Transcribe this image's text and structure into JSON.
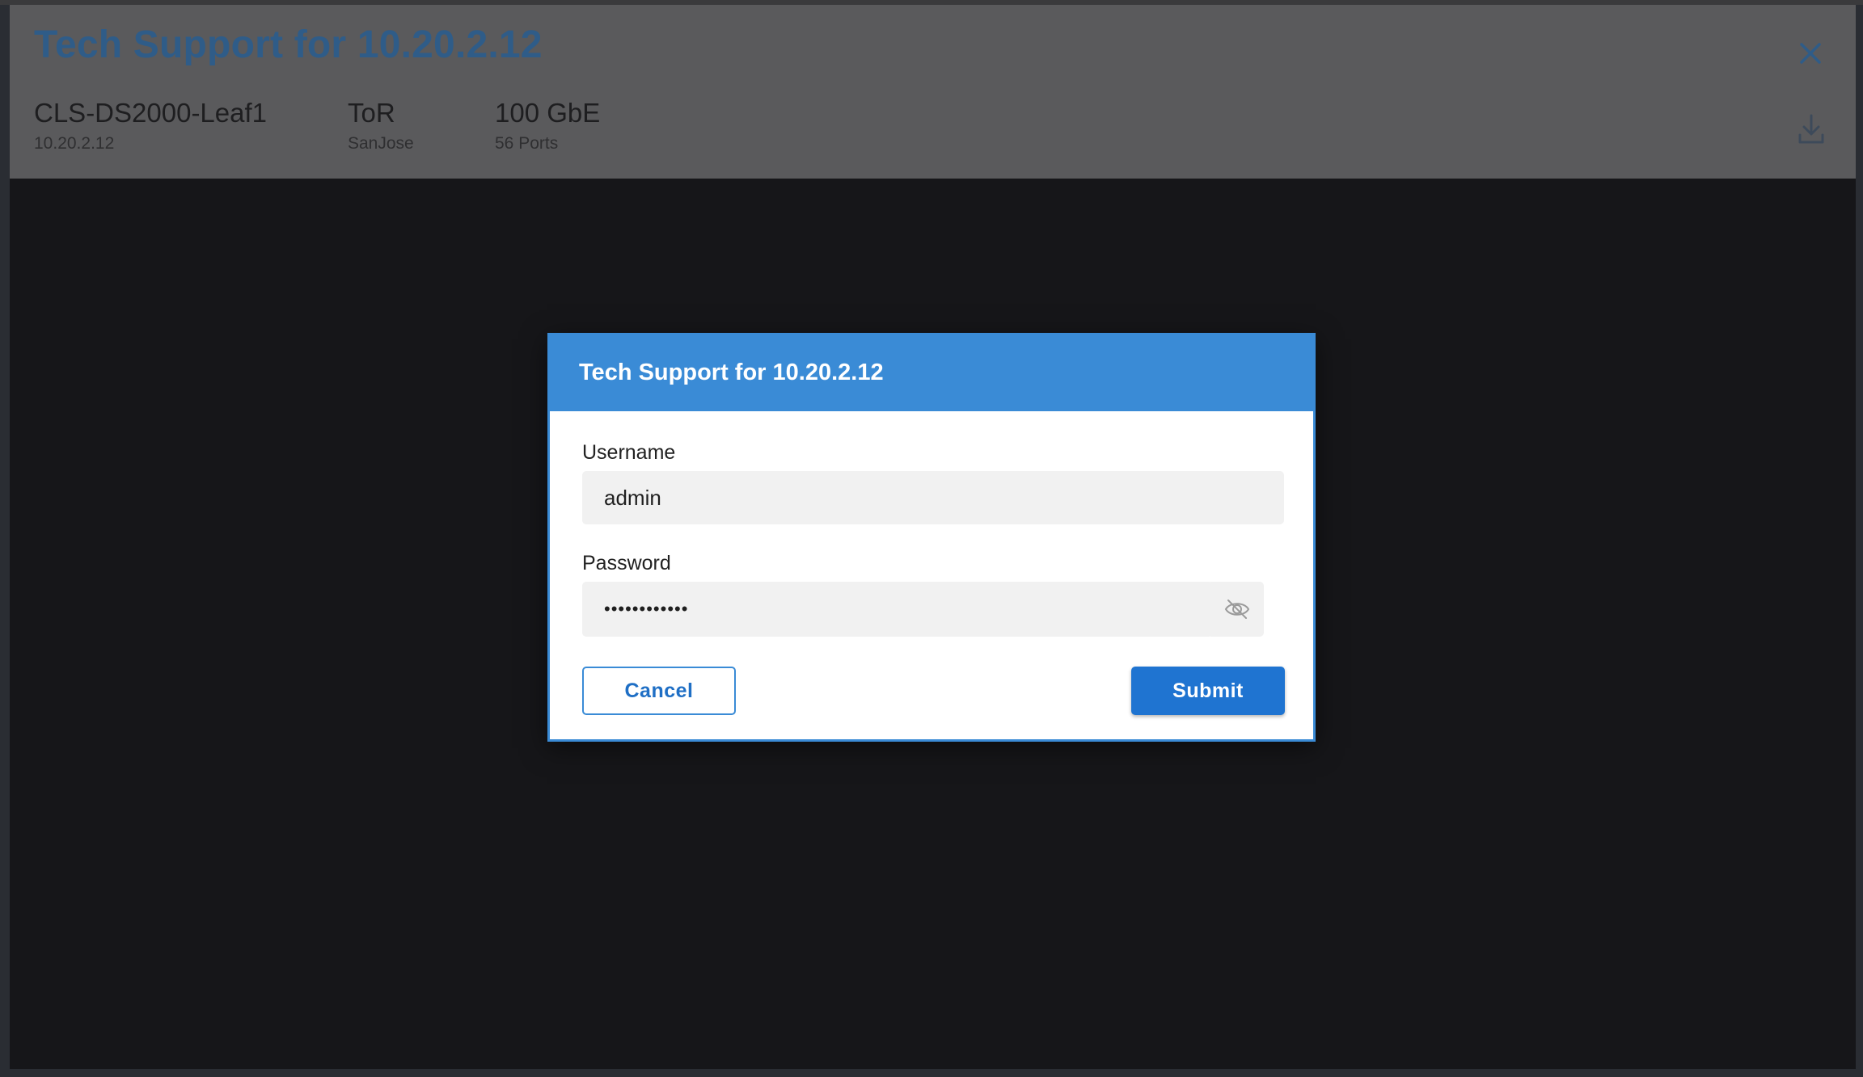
{
  "panel": {
    "title": "Tech Support for 10.20.2.12",
    "device": {
      "name": "CLS-DS2000-Leaf1",
      "ip": "10.20.2.12",
      "role": "ToR",
      "site": "SanJose",
      "speed": "100 GbE",
      "ports": "56 Ports"
    },
    "icons": {
      "close": "close-icon",
      "download": "download-icon"
    }
  },
  "modal": {
    "title": "Tech Support for 10.20.2.12",
    "username": {
      "label": "Username",
      "value": "admin"
    },
    "password": {
      "label": "Password",
      "value": "••••••••••••",
      "toggle_icon": "eye-off-icon"
    },
    "cancel_label": "Cancel",
    "submit_label": "Submit"
  },
  "colors": {
    "accent": "#3a8bd6",
    "primary_button": "#1f74d1",
    "overlay_header": "#5a5a5c",
    "title_text": "#2f5c88"
  }
}
